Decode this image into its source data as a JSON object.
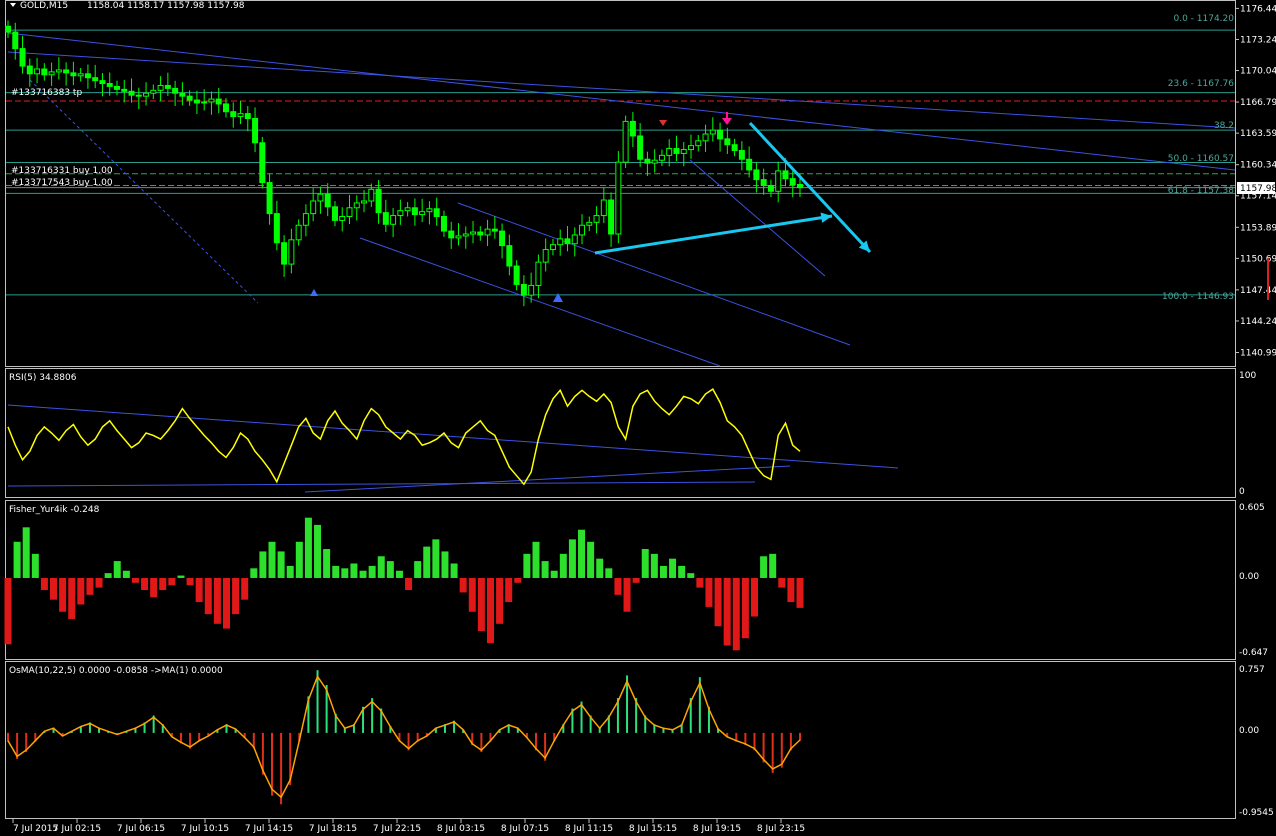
{
  "header": {
    "title": "GOLD,M15",
    "ohlc": "1158.04 1158.17 1157.98 1157.98"
  },
  "colors": {
    "bg": "#000000",
    "frame": "#c0c0c0",
    "bullBody": "#000000",
    "candle": "#00ff00",
    "trend": "#3c52e0",
    "cyan": "#19c8f0",
    "teal": "#2a9d8f",
    "rsi": "#ffff00",
    "fisherUp": "#2ce02c",
    "fisherDn": "#e01818",
    "osmaUp": "#2ce07c",
    "osmaDn": "#e03018",
    "osmaLine": "#ffa500"
  },
  "chart_data": [
    {
      "type": "candlestick",
      "title": "GOLD,M15",
      "ylim": [
        1139.6,
        1177.1
      ],
      "price_ticks": [
        "1176.44",
        "1173.24",
        "1170.04",
        "1166.79",
        "1163.59",
        "1160.34",
        "1157.14",
        "1153.89",
        "1150.69",
        "1147.44",
        "1144.24",
        "1140.99"
      ],
      "current_price": "1157.98",
      "x_labels": [
        "7 Jul 2015",
        "7 Jul 02:15",
        "7 Jul 06:15",
        "7 Jul 10:15",
        "7 Jul 14:15",
        "7 Jul 18:15",
        "7 Jul 22:15",
        "8 Jul 03:15",
        "8 Jul 07:15",
        "8 Jul 11:15",
        "8 Jul 15:15",
        "8 Jul 19:15",
        "8 Jul 23:15"
      ],
      "close": [
        1174.0,
        1172.3,
        1170.5,
        1169.7,
        1170.2,
        1169.6,
        1169.9,
        1170.1,
        1169.8,
        1169.5,
        1169.7,
        1169.3,
        1169.0,
        1168.7,
        1168.4,
        1168.1,
        1167.9,
        1167.5,
        1167.4,
        1167.7,
        1168.0,
        1168.5,
        1168.2,
        1167.7,
        1167.4,
        1167.0,
        1166.7,
        1166.8,
        1167.1,
        1166.6,
        1165.8,
        1165.3,
        1165.6,
        1165.1,
        1162.6,
        1158.5,
        1155.3,
        1152.3,
        1150.1,
        1152.6,
        1154.1,
        1155.3,
        1156.6,
        1157.3,
        1156.0,
        1154.6,
        1155.0,
        1155.9,
        1156.4,
        1156.6,
        1157.8,
        1155.4,
        1154.2,
        1155.1,
        1155.6,
        1155.9,
        1155.2,
        1155.5,
        1155.8,
        1155.0,
        1153.5,
        1152.8,
        1153.0,
        1153.2,
        1153.4,
        1153.1,
        1153.7,
        1153.5,
        1152.0,
        1149.9,
        1148.0,
        1146.9,
        1147.9,
        1150.3,
        1151.6,
        1152.1,
        1152.7,
        1152.2,
        1153.1,
        1154.1,
        1154.4,
        1155.1,
        1156.7,
        1153.2,
        1160.6,
        1164.8,
        1163.3,
        1160.9,
        1160.5,
        1160.8,
        1161.3,
        1162.0,
        1161.5,
        1161.9,
        1162.3,
        1162.8,
        1163.5,
        1163.9,
        1163.0,
        1162.4,
        1161.8,
        1160.9,
        1159.8,
        1158.8,
        1158.2,
        1157.6,
        1159.7,
        1158.9,
        1158.3,
        1157.98
      ],
      "levels": [
        {
          "label": "0.0 - 1174.20",
          "price": 1174.2
        },
        {
          "label": "23.6 - 1167.76",
          "price": 1167.76
        },
        {
          "label": "38.2",
          "price": 1163.9
        },
        {
          "label": "50.0 - 1160.57",
          "price": 1160.57
        },
        {
          "label": "61.8 - 1157.38",
          "price": 1157.38
        },
        {
          "label": "100.0 - 1146.93",
          "price": 1146.93
        }
      ],
      "orders": [
        {
          "label": "#133716383 tp",
          "price": 1166.9
        },
        {
          "label": "#133716331 buy 1.00",
          "price": 1159.4
        },
        {
          "label": "#133717543 buy 1.00",
          "price": 1158.2
        }
      ]
    },
    {
      "type": "line",
      "title": "RSI(5) 34.8806",
      "ylim": [
        0,
        100
      ],
      "y_ticks": [
        "100",
        "0"
      ],
      "values": [
        55,
        40,
        28,
        35,
        48,
        55,
        50,
        44,
        52,
        57,
        47,
        40,
        45,
        55,
        60,
        52,
        45,
        38,
        42,
        50,
        48,
        45,
        52,
        60,
        70,
        62,
        55,
        48,
        42,
        35,
        30,
        38,
        50,
        45,
        35,
        28,
        20,
        10,
        25,
        40,
        55,
        62,
        50,
        45,
        60,
        68,
        58,
        52,
        45,
        60,
        70,
        65,
        55,
        50,
        45,
        52,
        48,
        40,
        42,
        45,
        50,
        42,
        38,
        50,
        55,
        60,
        52,
        48,
        35,
        22,
        15,
        8,
        18,
        45,
        65,
        78,
        85,
        72,
        80,
        85,
        80,
        76,
        82,
        75,
        55,
        45,
        72,
        82,
        85,
        76,
        70,
        65,
        72,
        80,
        78,
        74,
        82,
        86,
        75,
        60,
        55,
        48,
        35,
        22,
        15,
        12,
        48,
        58,
        40,
        35
      ]
    },
    {
      "type": "bar",
      "title": "Fisher_Yur4ik -0.248",
      "ylim": [
        -0.647,
        0.605
      ],
      "y_ticks": [
        "0.605",
        "0.00",
        "-0.647"
      ],
      "values": [
        -0.55,
        0.3,
        0.42,
        0.2,
        -0.1,
        -0.18,
        -0.28,
        -0.34,
        -0.22,
        -0.14,
        -0.08,
        0.04,
        0.14,
        0.06,
        -0.04,
        -0.1,
        -0.16,
        -0.1,
        -0.06,
        0.02,
        -0.06,
        -0.2,
        -0.3,
        -0.38,
        -0.42,
        -0.3,
        -0.18,
        0.08,
        0.22,
        0.3,
        0.22,
        0.1,
        0.3,
        0.5,
        0.44,
        0.24,
        0.1,
        0.08,
        0.12,
        0.06,
        0.1,
        0.18,
        0.14,
        0.06,
        -0.1,
        0.14,
        0.26,
        0.32,
        0.22,
        0.12,
        -0.12,
        -0.28,
        -0.44,
        -0.54,
        -0.38,
        -0.2,
        -0.04,
        0.2,
        0.3,
        0.14,
        0.06,
        0.2,
        0.32,
        0.4,
        0.3,
        0.16,
        0.08,
        -0.14,
        -0.28,
        -0.04,
        0.24,
        0.2,
        0.1,
        0.16,
        0.1,
        0.04,
        -0.08,
        -0.24,
        -0.4,
        -0.56,
        -0.6,
        -0.5,
        -0.32,
        0.18,
        0.2,
        -0.08,
        -0.2,
        -0.248
      ]
    },
    {
      "type": "bar",
      "title": "OsMA(10,22,5) 0.0000 -0.0858  ->MA(1) 0.0000",
      "ylim": [
        -0.9545,
        0.757
      ],
      "y_ticks": [
        "0.757",
        "0.00",
        "-0.9545"
      ],
      "values": [
        -0.1,
        -0.3,
        -0.22,
        -0.1,
        0.02,
        0.06,
        -0.04,
        0.02,
        0.08,
        0.12,
        0.06,
        0.02,
        -0.02,
        0.02,
        0.06,
        0.12,
        0.2,
        0.1,
        -0.05,
        -0.12,
        -0.18,
        -0.1,
        -0.04,
        0.04,
        0.1,
        0.05,
        -0.06,
        -0.18,
        -0.48,
        -0.72,
        -0.82,
        -0.6,
        -0.1,
        0.42,
        0.72,
        0.55,
        0.22,
        0.06,
        0.1,
        0.3,
        0.4,
        0.28,
        0.08,
        -0.1,
        -0.2,
        -0.1,
        -0.04,
        0.06,
        0.1,
        0.14,
        0.04,
        -0.14,
        -0.22,
        -0.1,
        0.04,
        0.1,
        0.06,
        -0.06,
        -0.2,
        -0.32,
        -0.1,
        0.1,
        0.28,
        0.36,
        0.2,
        0.06,
        0.2,
        0.4,
        0.66,
        0.4,
        0.2,
        0.1,
        0.06,
        0.04,
        0.1,
        0.4,
        0.64,
        0.3,
        0.05,
        -0.05,
        -0.1,
        -0.14,
        -0.2,
        -0.34,
        -0.46,
        -0.4,
        -0.2,
        -0.09
      ]
    }
  ]
}
